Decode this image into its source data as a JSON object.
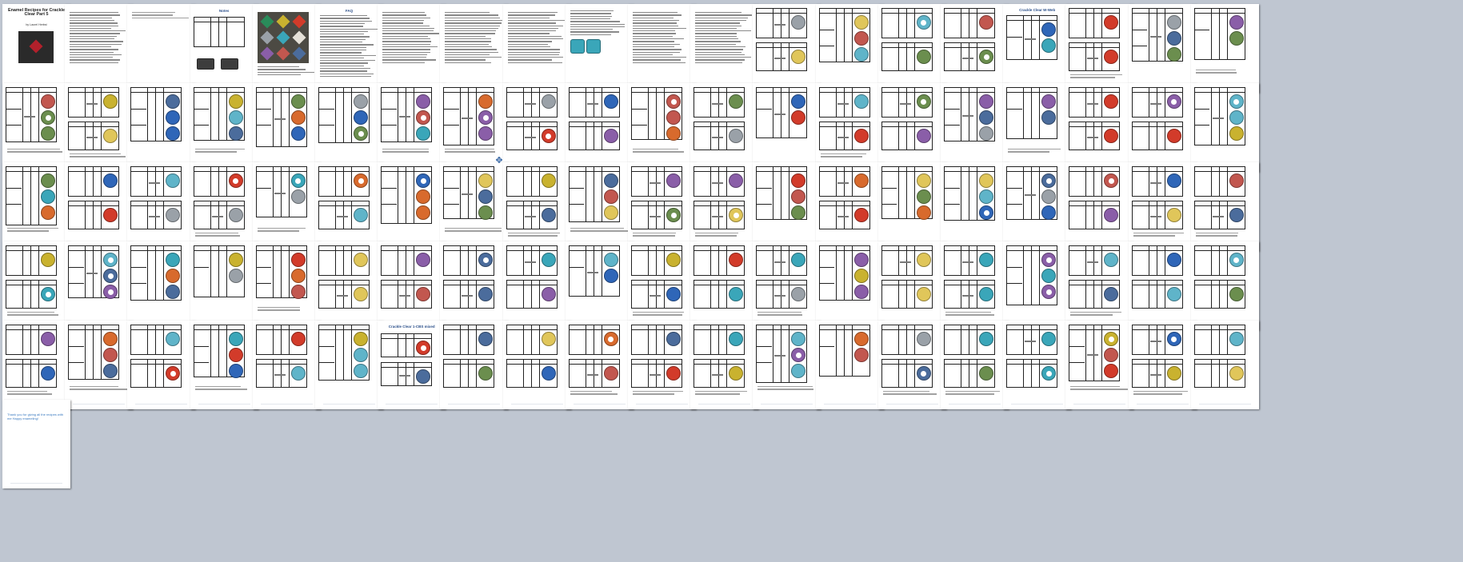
{
  "document": {
    "cover": {
      "title": "Enamel Recipes for Crackle Clear Part 5",
      "author": "by Laurel Herbst"
    },
    "section_titles": [
      "Notes",
      "FAQ",
      "Crackle Clear W-Web",
      "Crackle Clear 1-CBS mixed"
    ],
    "end_note": "Thank you for giving all the recipes with me Happy enameling!"
  },
  "colors": {
    "workspace": "#bfc6d1",
    "page": "#ffffff",
    "accent_title": "#2b4f8a",
    "link_blue": "#3a7ac0"
  },
  "icons": {
    "cursor": "move-cursor-icon"
  }
}
